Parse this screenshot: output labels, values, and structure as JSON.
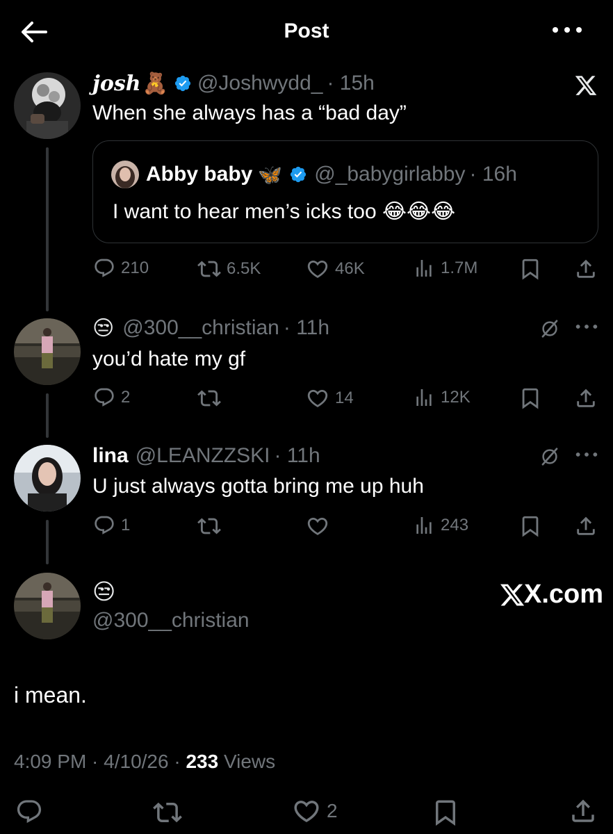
{
  "header": {
    "title": "Post"
  },
  "main_post": {
    "name": "josh",
    "name_emoji": "🧸",
    "handle": "@Joshwydd_",
    "time": "· 15h",
    "text": "When she always has a “bad day”",
    "quoted": {
      "name": "Abby baby",
      "name_emoji": "🦋",
      "handle": "@_babygirlabby",
      "time": "· 16h",
      "text": "I want to hear men’s icks too 😂😂😂"
    },
    "stats": {
      "replies": "210",
      "reposts": "6.5K",
      "likes": "46K",
      "views": "1.7M"
    }
  },
  "reply1": {
    "name_emoji": "😒",
    "handle": "@300__christian",
    "time": "· 11h",
    "text": "you’d hate my gf",
    "stats": {
      "replies": "2",
      "reposts": "",
      "likes": "14",
      "views": "12K"
    }
  },
  "reply2": {
    "name": "lina",
    "handle": "@LEANZZSKI",
    "time": "· 11h",
    "text": "U just always gotta bring me up huh",
    "stats": {
      "replies": "1",
      "reposts": "",
      "likes": "",
      "views": "243"
    }
  },
  "focused_post": {
    "name_emoji": "😒",
    "handle": "@300__christian",
    "brand": "X.com",
    "text": "i mean.",
    "timestamp": "4:09 PM · 4/10/26 ·",
    "views_count": "233",
    "views_label": "Views",
    "stats": {
      "likes": "2"
    }
  },
  "icons": {
    "back": "arrow-left-icon",
    "more": "more-icon",
    "x_logo": "x-logo-icon",
    "verified": "verified-badge-icon",
    "reply": "reply-icon",
    "repost": "repost-icon",
    "like": "heart-icon",
    "views": "views-icon",
    "bookmark": "bookmark-icon",
    "share": "share-icon",
    "grok": "grok-icon"
  },
  "colors": {
    "background": "#000000",
    "text": "#e7e9ea",
    "muted": "#71767b",
    "verified": "#1d9bf0",
    "border": "#2f3336"
  }
}
